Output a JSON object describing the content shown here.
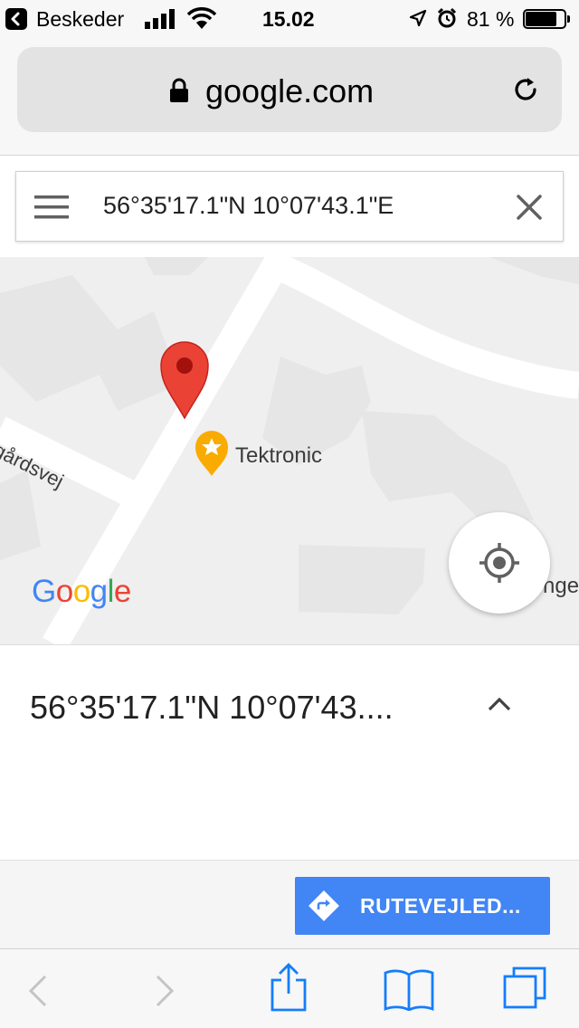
{
  "status_bar": {
    "back_app": "Beskeder",
    "time": "15.02",
    "battery_percent": "81 %",
    "battery_level": 0.81
  },
  "browser": {
    "url": "google.com"
  },
  "search": {
    "query": "56°35'17.1\"N 10°07'43.1\"E"
  },
  "map": {
    "street_label": "igårdsvej",
    "place_label": "Tektronic",
    "edge_label": "nge",
    "logo": "Google",
    "colors": {
      "background": "#efefef",
      "building": "#e6e6e6",
      "road": "#ffffff",
      "pin": "#ea4335",
      "place_icon": "#f9ab00"
    }
  },
  "sheet": {
    "title": "56°35'17.1\"N 10°07'43...."
  },
  "actions": {
    "directions_label": "RUTEVEJLED...",
    "accent": "#4285f4"
  },
  "toolbar": {
    "icons": [
      "back-icon",
      "forward-icon",
      "share-icon",
      "bookmarks-icon",
      "tabs-icon"
    ]
  }
}
